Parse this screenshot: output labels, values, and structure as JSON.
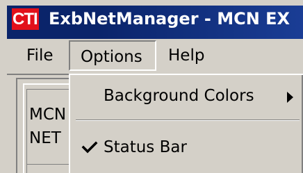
{
  "window": {
    "logo": "CTI",
    "title": "ExbNetManager - MCN EX"
  },
  "menubar": {
    "items": [
      {
        "label": "File"
      },
      {
        "label": "Options",
        "active": true
      },
      {
        "label": "Help"
      }
    ]
  },
  "client": {
    "lines": [
      "MCN",
      "NET"
    ]
  },
  "dropdown": {
    "items": [
      {
        "label": "Background Colors",
        "submenu": true,
        "icon": "chevron-right-icon"
      },
      {
        "separator": true
      },
      {
        "label": "Status Bar",
        "checked": true,
        "icon": "checkmark-icon"
      }
    ]
  },
  "colors": {
    "titlebar": "#0a246a",
    "logo_bg": "#e2101a",
    "face": "#d4d0c8"
  }
}
